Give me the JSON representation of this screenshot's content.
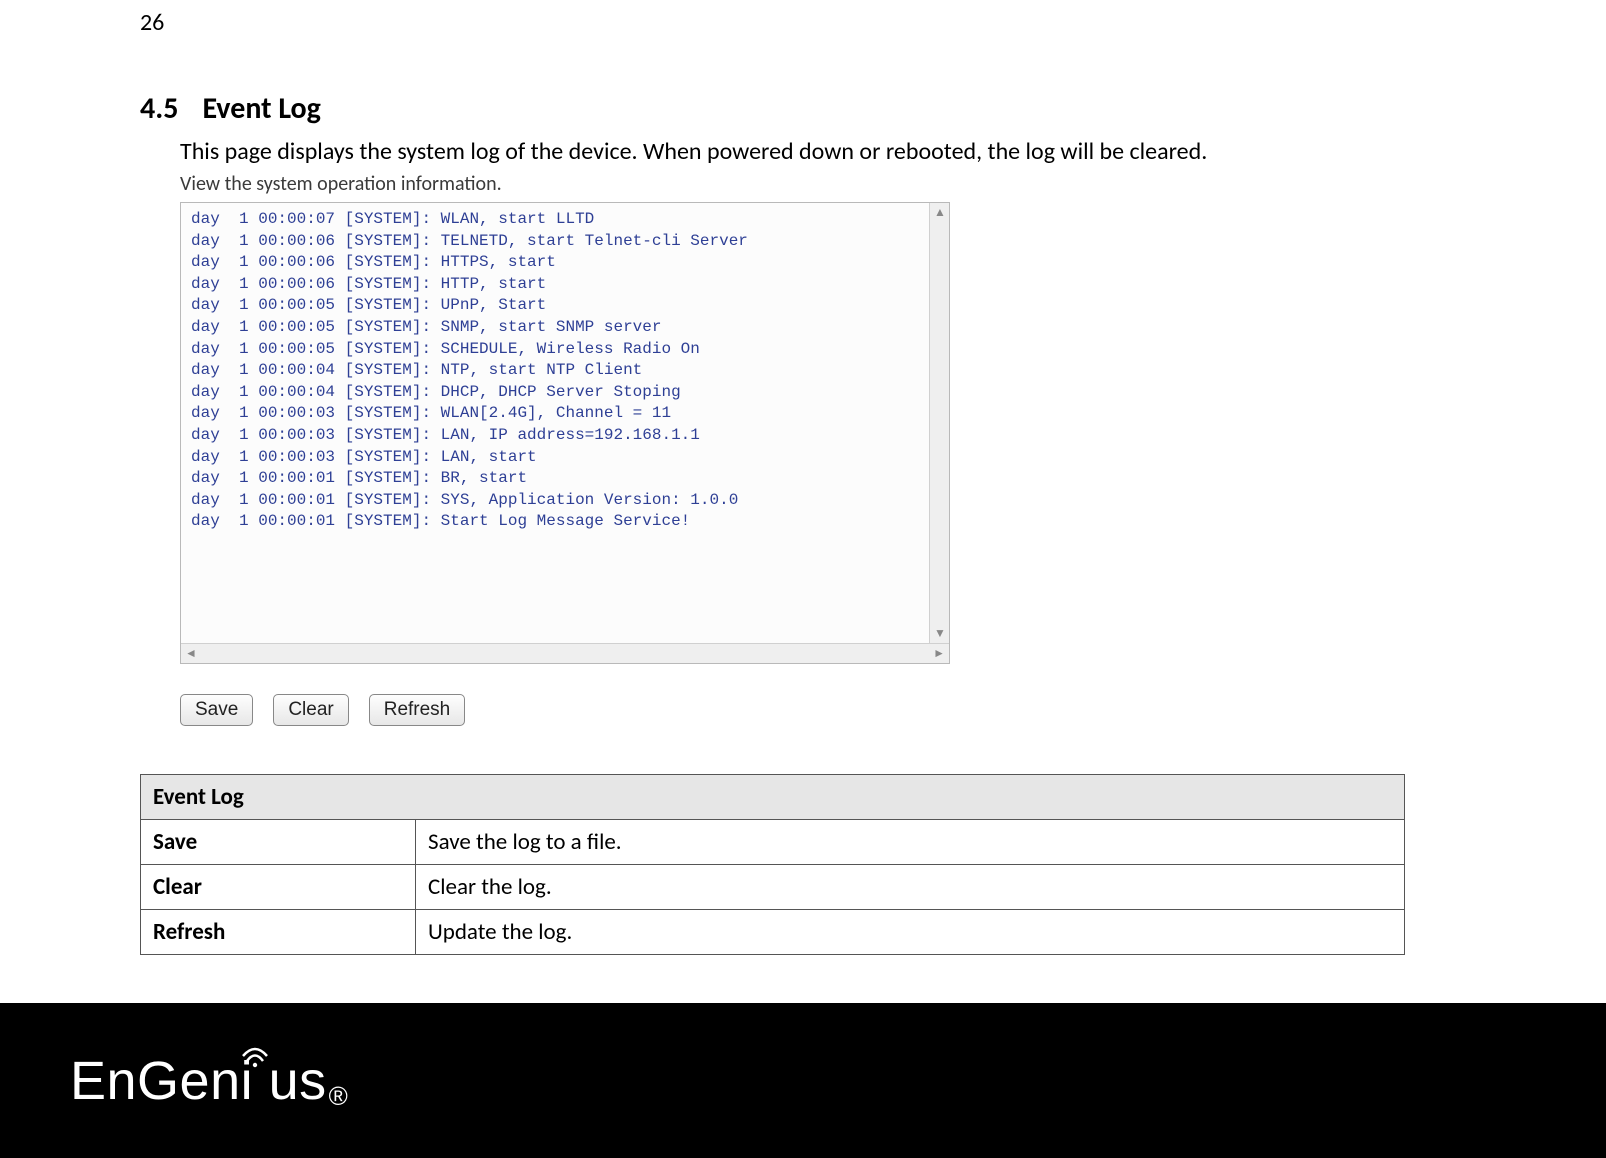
{
  "pageNumber": "26",
  "heading": {
    "num": "4.5",
    "title": "Event Log"
  },
  "intro": "This page displays the system log of the device. When powered down or rebooted, the log will be cleared.",
  "subcaption": "View the system operation information.",
  "log": {
    "lines": [
      "day  1 00:00:07 [SYSTEM]: WLAN, start LLTD",
      "day  1 00:00:06 [SYSTEM]: TELNETD, start Telnet-cli Server",
      "day  1 00:00:06 [SYSTEM]: HTTPS, start",
      "day  1 00:00:06 [SYSTEM]: HTTP, start",
      "day  1 00:00:05 [SYSTEM]: UPnP, Start",
      "day  1 00:00:05 [SYSTEM]: SNMP, start SNMP server",
      "day  1 00:00:05 [SYSTEM]: SCHEDULE, Wireless Radio On",
      "day  1 00:00:04 [SYSTEM]: NTP, start NTP Client",
      "day  1 00:00:04 [SYSTEM]: DHCP, DHCP Server Stoping",
      "day  1 00:00:03 [SYSTEM]: WLAN[2.4G], Channel = 11",
      "day  1 00:00:03 [SYSTEM]: LAN, IP address=192.168.1.1",
      "day  1 00:00:03 [SYSTEM]: LAN, start",
      "day  1 00:00:01 [SYSTEM]: BR, start",
      "day  1 00:00:01 [SYSTEM]: SYS, Application Version: 1.0.0",
      "day  1 00:00:01 [SYSTEM]: Start Log Message Service!"
    ]
  },
  "buttons": {
    "save": "Save",
    "clear": "Clear",
    "refresh": "Refresh"
  },
  "table": {
    "header": "Event Log",
    "rows": [
      {
        "key": "Save",
        "val": "Save the log to a file."
      },
      {
        "key": "Clear",
        "val": "Clear the log."
      },
      {
        "key": "Refresh",
        "val": "Update the log."
      }
    ]
  },
  "brand": {
    "name_a": "EnGen",
    "name_b": "us",
    "reg": "®"
  }
}
